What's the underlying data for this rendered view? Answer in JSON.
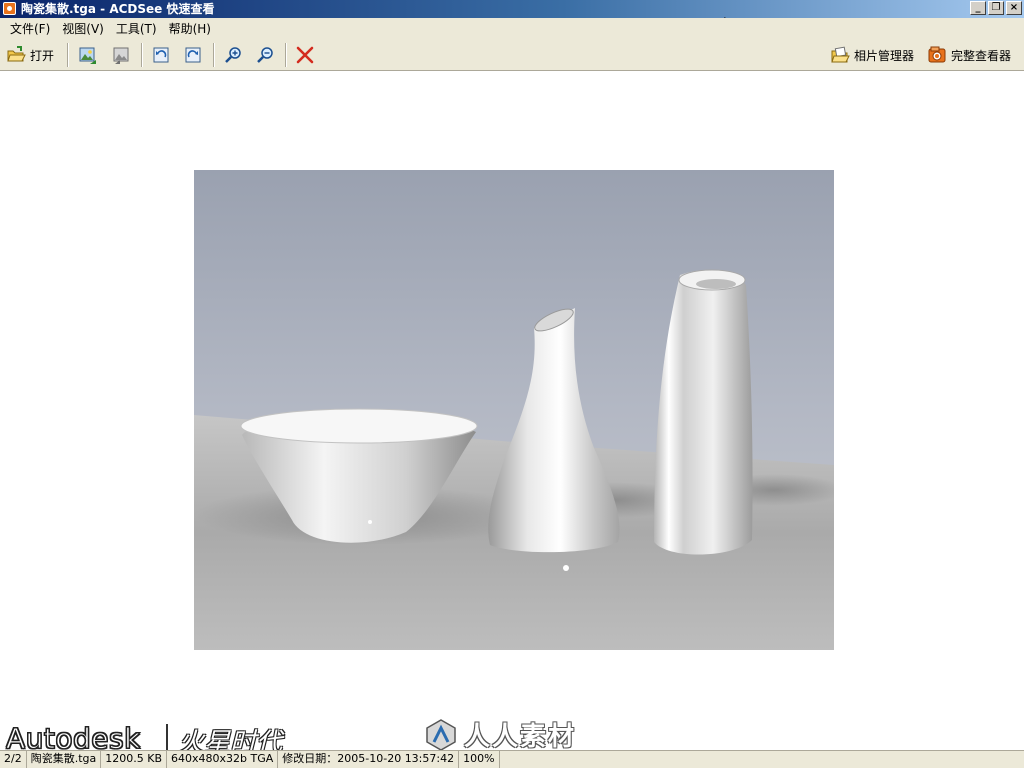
{
  "window": {
    "title": "陶瓷集散.tga - ACDSee 快速查看",
    "minimize_glyph": "_",
    "restore_glyph": "❐",
    "close_glyph": "×"
  },
  "menu": [
    {
      "label": "文件(F)"
    },
    {
      "label": "视图(V)"
    },
    {
      "label": "工具(T)"
    },
    {
      "label": "帮助(H)"
    }
  ],
  "toolbar": {
    "open_label": "打开",
    "photo_manager_label": "相片管理器",
    "full_viewer_label": "完整查看器",
    "icons": [
      "open-folder-icon",
      "previous-image-icon",
      "next-image-icon",
      "rotate-left-icon",
      "rotate-right-icon",
      "zoom-in-icon",
      "zoom-out-icon",
      "delete-icon",
      "photo-manager-icon",
      "full-viewer-icon"
    ]
  },
  "status": {
    "index": "2/2",
    "filename": "陶瓷集散.tga",
    "filesize": "1200.5 KB",
    "dimensions": "640x480x32b TGA",
    "modified": "修改日期：2005-10-20 13:57:42",
    "zoom": "100%"
  },
  "watermarks": {
    "autodesk": "Autodesk",
    "hx": "火星时代",
    "rr": "人人素材"
  },
  "colors": {
    "titlebar_start": "#0a246a",
    "titlebar_end": "#a6caf0",
    "chrome": "#ece9d8",
    "delete_red": "#d42b1e",
    "background": "#ffffff"
  }
}
